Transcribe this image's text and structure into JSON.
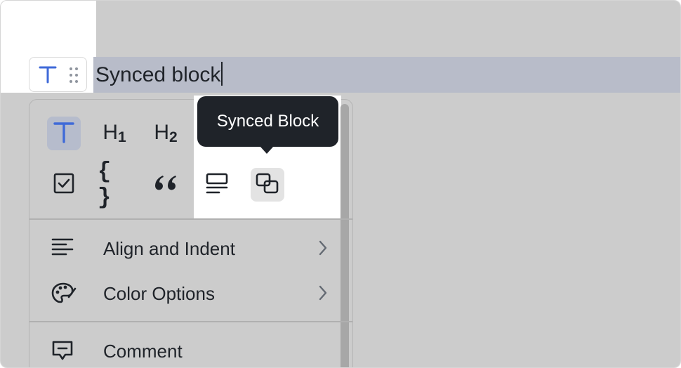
{
  "editor": {
    "block_text": "Synced block"
  },
  "block_types": [
    {
      "name": "text",
      "icon": "text-t-icon",
      "active": true
    },
    {
      "name": "heading-1",
      "label": "H",
      "sub": "1"
    },
    {
      "name": "heading-2",
      "label": "H",
      "sub": "2"
    },
    {
      "name": "todo",
      "icon": "checkbox-icon"
    },
    {
      "name": "code",
      "label": "{ }",
      "icon": "code-braces-icon"
    },
    {
      "name": "quote",
      "icon": "quote-icon"
    },
    {
      "name": "callout",
      "icon": "callout-icon"
    },
    {
      "name": "synced-block",
      "icon": "synced-block-icon",
      "hovered": true
    }
  ],
  "tooltip": {
    "text": "Synced Block"
  },
  "menu": {
    "align_label": "Align and Indent",
    "color_label": "Color Options",
    "comment_label": "Comment"
  },
  "colors": {
    "accent": "#3f6ad8",
    "active_bg": "#b6bccc",
    "overlay": "#cccccc",
    "tooltip_bg": "#1f2329",
    "text": "#1f2329"
  }
}
